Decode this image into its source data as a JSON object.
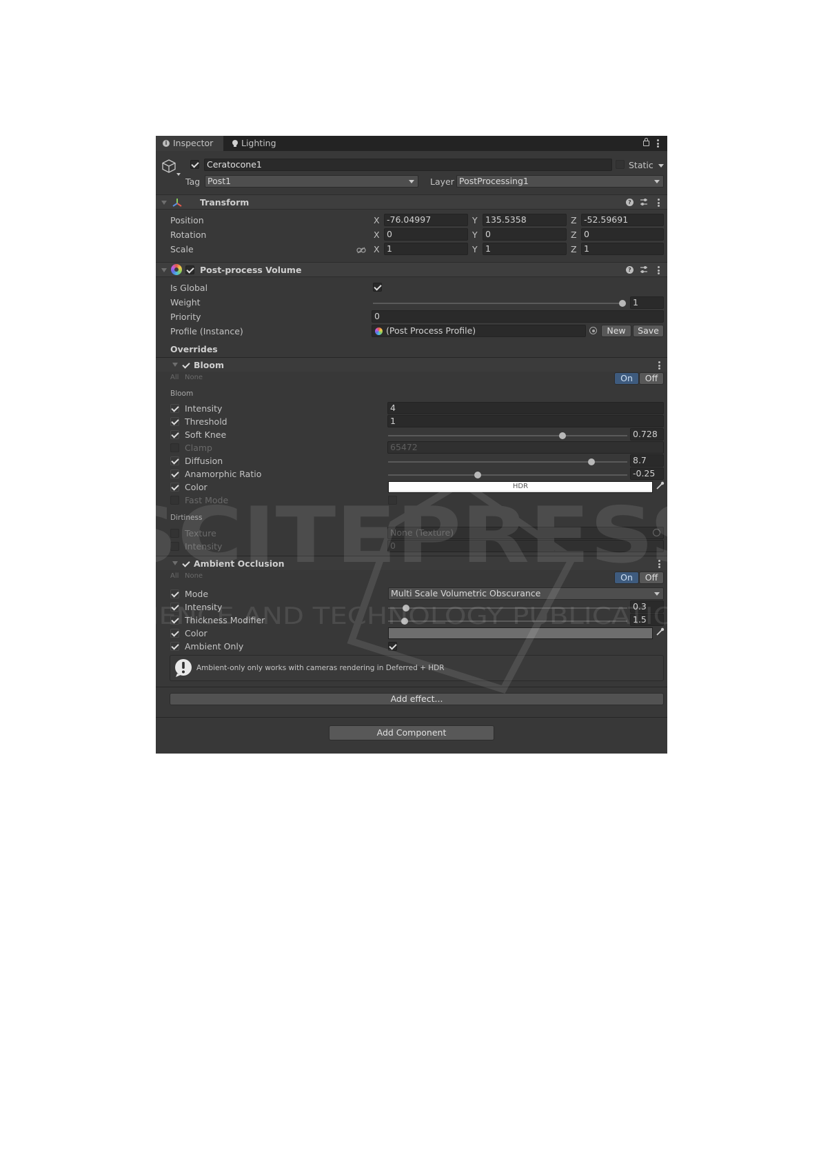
{
  "tabs": {
    "inspector": "Inspector",
    "lighting": "Lighting"
  },
  "object": {
    "name": "Ceratocone1",
    "static_label": "Static",
    "tag_label": "Tag",
    "tag_value": "Post1",
    "layer_label": "Layer",
    "layer_value": "PostProcessing1"
  },
  "transform": {
    "title": "Transform",
    "position": {
      "label": "Position",
      "x": "-76.04997",
      "y": "135.5358",
      "z": "-52.59691"
    },
    "rotation": {
      "label": "Rotation",
      "x": "0",
      "y": "0",
      "z": "0"
    },
    "scale": {
      "label": "Scale",
      "x": "1",
      "y": "1",
      "z": "1"
    },
    "axis_x": "X",
    "axis_y": "Y",
    "axis_z": "Z"
  },
  "volume": {
    "title": "Post-process Volume",
    "is_global_label": "Is Global",
    "weight_label": "Weight",
    "weight_value": "1",
    "weight_fraction": 1.0,
    "priority_label": "Priority",
    "priority_value": "0",
    "profile_label": "Profile (Instance)",
    "profile_value": "(Post Process Profile)",
    "new_button": "New",
    "save_button": "Save",
    "overrides_label": "Overrides"
  },
  "bloom": {
    "title": "Bloom",
    "all": "All",
    "none": "None",
    "on": "On",
    "off": "Off",
    "section_bloom": "Bloom",
    "intensity_label": "Intensity",
    "intensity_value": "4",
    "threshold_label": "Threshold",
    "threshold_value": "1",
    "soft_knee_label": "Soft Knee",
    "soft_knee_value": "0.728",
    "soft_knee_fraction": 0.728,
    "clamp_label": "Clamp",
    "clamp_value": "65472",
    "diffusion_label": "Diffusion",
    "diffusion_value": "8.7",
    "diffusion_fraction": 0.85,
    "anamorphic_label": "Anamorphic Ratio",
    "anamorphic_value": "-0.25",
    "anamorphic_fraction": 0.375,
    "color_label": "Color",
    "color_hdr": "HDR",
    "fast_mode_label": "Fast Mode",
    "section_dirtiness": "Dirtiness",
    "texture_label": "Texture",
    "texture_value": "None (Texture)",
    "dirt_intensity_label": "Intensity",
    "dirt_intensity_value": "0"
  },
  "ao": {
    "title": "Ambient Occlusion",
    "all": "All",
    "none": "None",
    "on": "On",
    "off": "Off",
    "mode_label": "Mode",
    "mode_value": "Multi Scale Volumetric Obscurance",
    "intensity_label": "Intensity",
    "intensity_value": "0.3",
    "intensity_fraction": 0.075,
    "thickness_label": "Thickness Modifier",
    "thickness_value": "1.5",
    "thickness_fraction": 0.07,
    "color_label": "Color",
    "ambient_only_label": "Ambient Only",
    "warning": "Ambient-only only works with cameras rendering in Deferred + HDR"
  },
  "footer": {
    "add_effect": "Add effect...",
    "add_component": "Add Component"
  },
  "watermark": {
    "line1": "SCITEPRESS",
    "line2": "SCIENCE AND TECHNOLOGY PUBLICATIONS"
  },
  "colors": {
    "panel_bg": "#383838",
    "field_bg": "#2a2a2a",
    "accent_on": "#3e5b7e"
  }
}
